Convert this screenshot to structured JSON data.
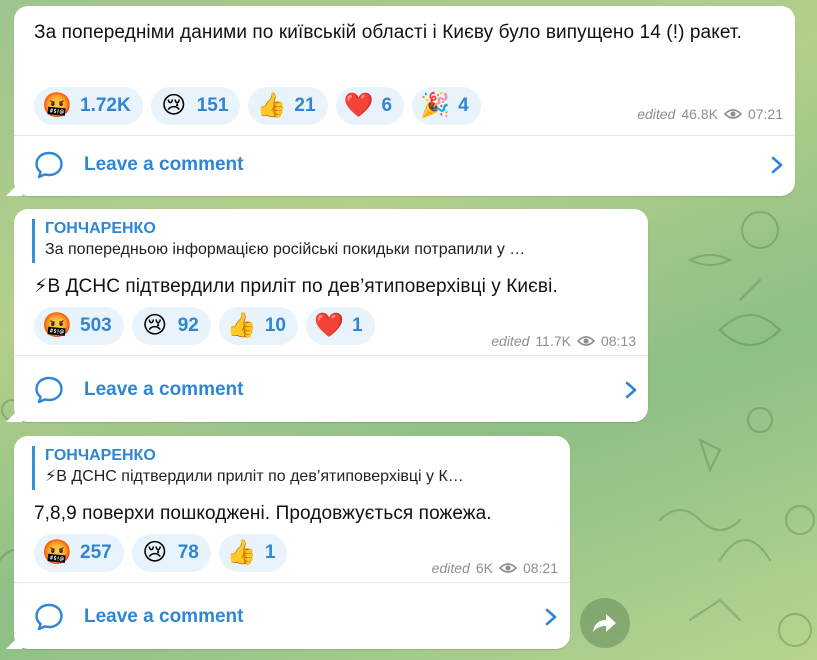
{
  "messages": [
    {
      "text": "За попередніми даними по київській області і Києву було випущено 14 (!) ракет.",
      "reactions": [
        {
          "emoji": "🤬",
          "count": "1.72K"
        },
        {
          "emoji": "😢",
          "count": "151"
        },
        {
          "emoji": "👍",
          "count": "21"
        },
        {
          "emoji": "❤️",
          "count": "6"
        },
        {
          "emoji": "🎉",
          "count": "4"
        }
      ],
      "edited": "edited",
      "views": "46.8K",
      "time": "07:21",
      "comment_label": "Leave a comment"
    },
    {
      "reply_author": "ГОНЧАРЕНКО",
      "reply_text": "За попередньою інформацією російські покидьки потрапили у …",
      "text": "⚡В ДСНС підтвердили приліт по дев’ятиповерхівці у Києві.",
      "reactions": [
        {
          "emoji": "🤬",
          "count": "503"
        },
        {
          "emoji": "😢",
          "count": "92"
        },
        {
          "emoji": "👍",
          "count": "10"
        },
        {
          "emoji": "❤️",
          "count": "1"
        }
      ],
      "edited": "edited",
      "views": "11.7K",
      "time": "08:13",
      "comment_label": "Leave a comment"
    },
    {
      "reply_author": "ГОНЧАРЕНКО",
      "reply_text": "⚡В ДСНС підтвердили приліт по дев’ятиповерхівці у К…",
      "text": "7,8,9 поверхи пошкоджені. Продовжується пожежа.",
      "reactions": [
        {
          "emoji": "🤬",
          "count": "257"
        },
        {
          "emoji": "😢",
          "count": "78"
        },
        {
          "emoji": "👍",
          "count": "1"
        }
      ],
      "edited": "edited",
      "views": "6K",
      "time": "08:21",
      "comment_label": "Leave a comment"
    }
  ],
  "icons": {
    "comment": "comment-bubble-icon",
    "chevron": "chevron-right-icon",
    "views": "eye-icon",
    "share": "share-arrow-icon"
  },
  "colors": {
    "accent": "#2f86d4",
    "reaction_bg": "#e9f3fb",
    "meta": "#8a8f95"
  }
}
